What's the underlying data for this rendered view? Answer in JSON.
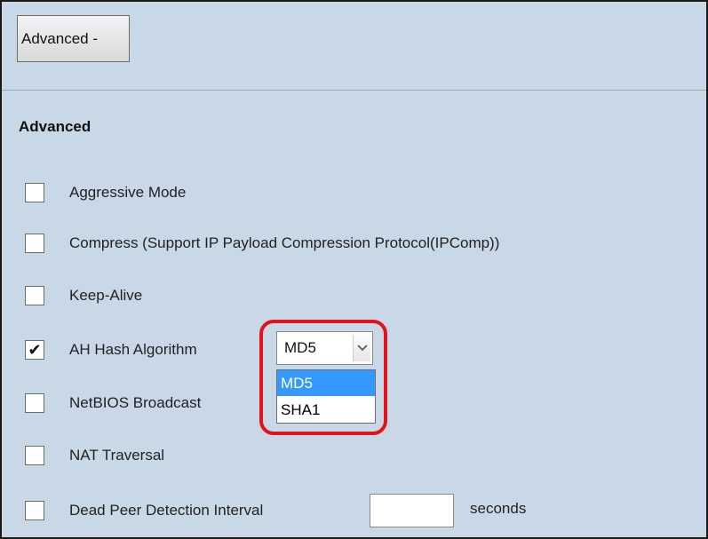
{
  "advanced_toggle": {
    "label": "Advanced -"
  },
  "section": {
    "title": "Advanced"
  },
  "options": [
    {
      "label": "Aggressive Mode",
      "checked": false
    },
    {
      "label": "Compress (Support IP Payload Compression Protocol(IPComp))",
      "checked": false
    },
    {
      "label": "Keep-Alive",
      "checked": false
    },
    {
      "label": "AH Hash Algorithm",
      "checked": true
    },
    {
      "label": "NetBIOS Broadcast",
      "checked": false
    },
    {
      "label": "NAT Traversal",
      "checked": false
    },
    {
      "label": "Dead Peer Detection Interval",
      "checked": false
    }
  ],
  "ah_hash_select": {
    "value": "MD5",
    "options": [
      "MD5",
      "SHA1"
    ],
    "highlighted": "MD5"
  },
  "dead_peer_detection": {
    "value": "",
    "unit": "seconds"
  },
  "colors": {
    "panel_background": "#c9d8e6",
    "highlight_ring": "#e2131b",
    "selected_option": "#3399ff"
  },
  "icons": {
    "check": "check-icon",
    "dropdown": "chevron-down-icon"
  }
}
